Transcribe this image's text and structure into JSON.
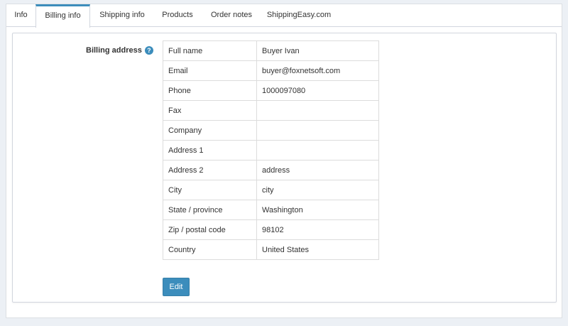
{
  "tabs": [
    {
      "label": "Info",
      "active": false
    },
    {
      "label": "Billing info",
      "active": true
    },
    {
      "label": "Shipping info",
      "active": false
    },
    {
      "label": "Products",
      "active": false
    },
    {
      "label": "Order notes",
      "active": false
    },
    {
      "label": "ShippingEasy.com",
      "active": false
    }
  ],
  "billing": {
    "section_label": "Billing address",
    "help_icon": "question-circle-icon",
    "rows": [
      {
        "label": "Full name",
        "value": "Buyer Ivan"
      },
      {
        "label": "Email",
        "value": "buyer@foxnetsoft.com"
      },
      {
        "label": "Phone",
        "value": "1000097080"
      },
      {
        "label": "Fax",
        "value": ""
      },
      {
        "label": "Company",
        "value": ""
      },
      {
        "label": "Address 1",
        "value": ""
      },
      {
        "label": "Address 2",
        "value": "address"
      },
      {
        "label": "City",
        "value": "city"
      },
      {
        "label": "State / province",
        "value": "Washington"
      },
      {
        "label": "Zip / postal code",
        "value": "98102"
      },
      {
        "label": "Country",
        "value": "United States"
      }
    ],
    "edit_label": "Edit"
  },
  "colors": {
    "accent": "#3c8dbc",
    "background": "#ecf0f5"
  }
}
